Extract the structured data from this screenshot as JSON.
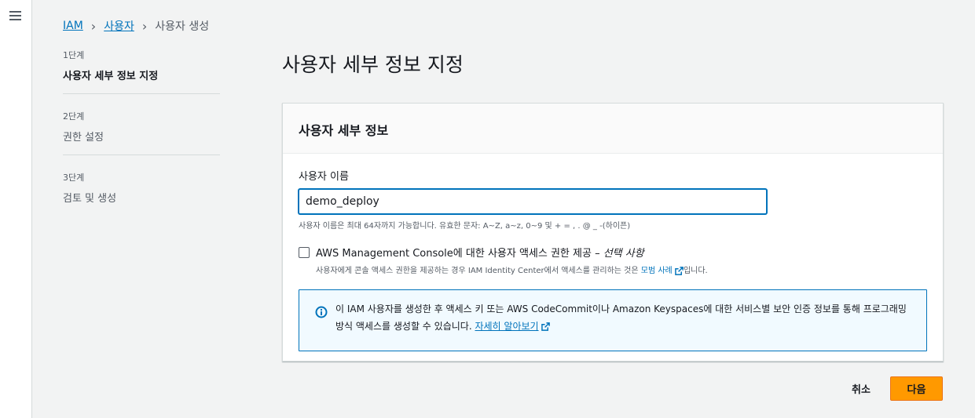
{
  "breadcrumb": {
    "iam": "IAM",
    "users": "사용자",
    "current": "사용자 생성"
  },
  "steps": [
    {
      "num": "1단계",
      "title": "사용자 세부 정보 지정"
    },
    {
      "num": "2단계",
      "title": "권한 설정"
    },
    {
      "num": "3단계",
      "title": "검토 및 생성"
    }
  ],
  "page_title": "사용자 세부 정보 지정",
  "panel": {
    "header": "사용자 세부 정보",
    "username_label": "사용자 이름",
    "username_value": "demo_deploy",
    "username_hint": "사용자 이름은 최대 64자까지 가능합니다. 유효한 문자: A~Z, a~z, 0~9 및 + = , . @ _ -(하이픈)",
    "console_access_label": "AWS Management Console에 대한 사용자 액세스 권한 제공 –",
    "console_access_optional": "선택 사항",
    "console_access_desc_pre": "사용자에게 콘솔 액세스 권한을 제공하는 경우 IAM Identity Center에서 액세스를 관리하는 것은",
    "console_access_link": "모범 사례",
    "console_access_desc_post": "입니다.",
    "info_text": "이 IAM 사용자를 생성한 후 액세스 키 또는 AWS CodeCommit이나 Amazon Keyspaces에 대한 서비스별 보안 인증 정보를 통해 프로그래밍 방식 액세스를 생성할 수 있습니다.",
    "info_link": "자세히 알아보기"
  },
  "actions": {
    "cancel": "취소",
    "next": "다음"
  },
  "colors": {
    "accent": "#0073bb",
    "primary_button": "#ff9900"
  }
}
